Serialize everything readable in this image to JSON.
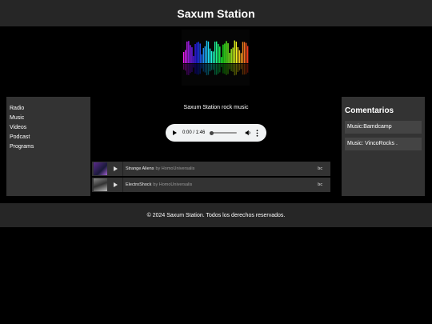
{
  "header": {
    "title": "Saxum Station"
  },
  "sidebar": {
    "items": [
      {
        "label": "Radio"
      },
      {
        "label": "Music"
      },
      {
        "label": "Videos"
      },
      {
        "label": "Podcast"
      },
      {
        "label": "Programs"
      }
    ]
  },
  "main": {
    "caption": "Saxum Station rock music",
    "player": {
      "time": "0:00 / 1:46",
      "progress": 0
    },
    "tracks": [
      {
        "title": "Strange Aliens",
        "by": "by HomoUniversalis",
        "badge": "bc"
      },
      {
        "title": "ElectroShock",
        "by": "by HomoUniversalis",
        "badge": "bc"
      }
    ]
  },
  "comments": {
    "title": "Comentarios",
    "items": [
      {
        "label": "Music:Bamdcamp"
      },
      {
        "label": "Music: VincoRocks ."
      }
    ]
  },
  "footer": {
    "text": "© 2024 Saxum Station. Todos los derechos reservados."
  },
  "colors": {
    "background": "#000000",
    "panel": "#333333",
    "header": "#262626",
    "player": "#f1f3f4"
  }
}
